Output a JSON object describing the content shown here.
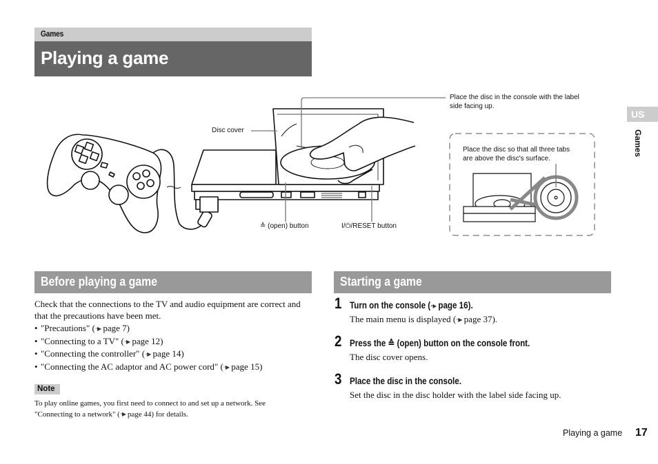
{
  "header": {
    "section": "Games",
    "title": "Playing a game"
  },
  "side_tab": {
    "region": "US",
    "label": "Games"
  },
  "figure": {
    "callouts": {
      "place_disc": [
        "Place the disc in the console with the label",
        "side facing up."
      ],
      "disc_cover": "Disc cover",
      "open_button": "≙ (open) button",
      "reset_button": "I/⏻/RESET button",
      "inset": [
        "Place the disc so that all three tabs",
        "are above the disc's surface."
      ]
    }
  },
  "before": {
    "heading": "Before playing a game",
    "intro": [
      "Check that the connections to the TV and audio equipment are correct and",
      "that the precautions have been met."
    ],
    "xref_symbol": "··▶",
    "items": [
      {
        "text": "\"Precautions\" (",
        "page": "page 7)"
      },
      {
        "text": "\"Connecting to a TV\" (",
        "page": "page 12)"
      },
      {
        "text": "\"Connecting the controller\" (",
        "page": "page 14)"
      },
      {
        "text": "\"Connecting the AC adaptor and AC power cord\" (",
        "page": "page 15)"
      }
    ],
    "note": {
      "label": "Note",
      "line1": "To play online games, you first need to connect to and set up a network. See",
      "line2_pre": "\"Connecting to a network\" (",
      "line2_post": "page 44) for details."
    }
  },
  "starting": {
    "heading": "Starting a game",
    "steps": [
      {
        "num": "1",
        "title_pre": "Turn on the console (",
        "title_post": "page 16).",
        "desc_pre": "The main menu is displayed (",
        "desc_post": "page 37)."
      },
      {
        "num": "2",
        "title": "Press the ≙ (open) button on the console front.",
        "desc": "The disc cover opens."
      },
      {
        "num": "3",
        "title": "Place the disc in the console.",
        "desc": "Set the disc in the disc holder with the label side facing up."
      }
    ]
  },
  "footer": {
    "label": "Playing a game",
    "page": "17"
  }
}
